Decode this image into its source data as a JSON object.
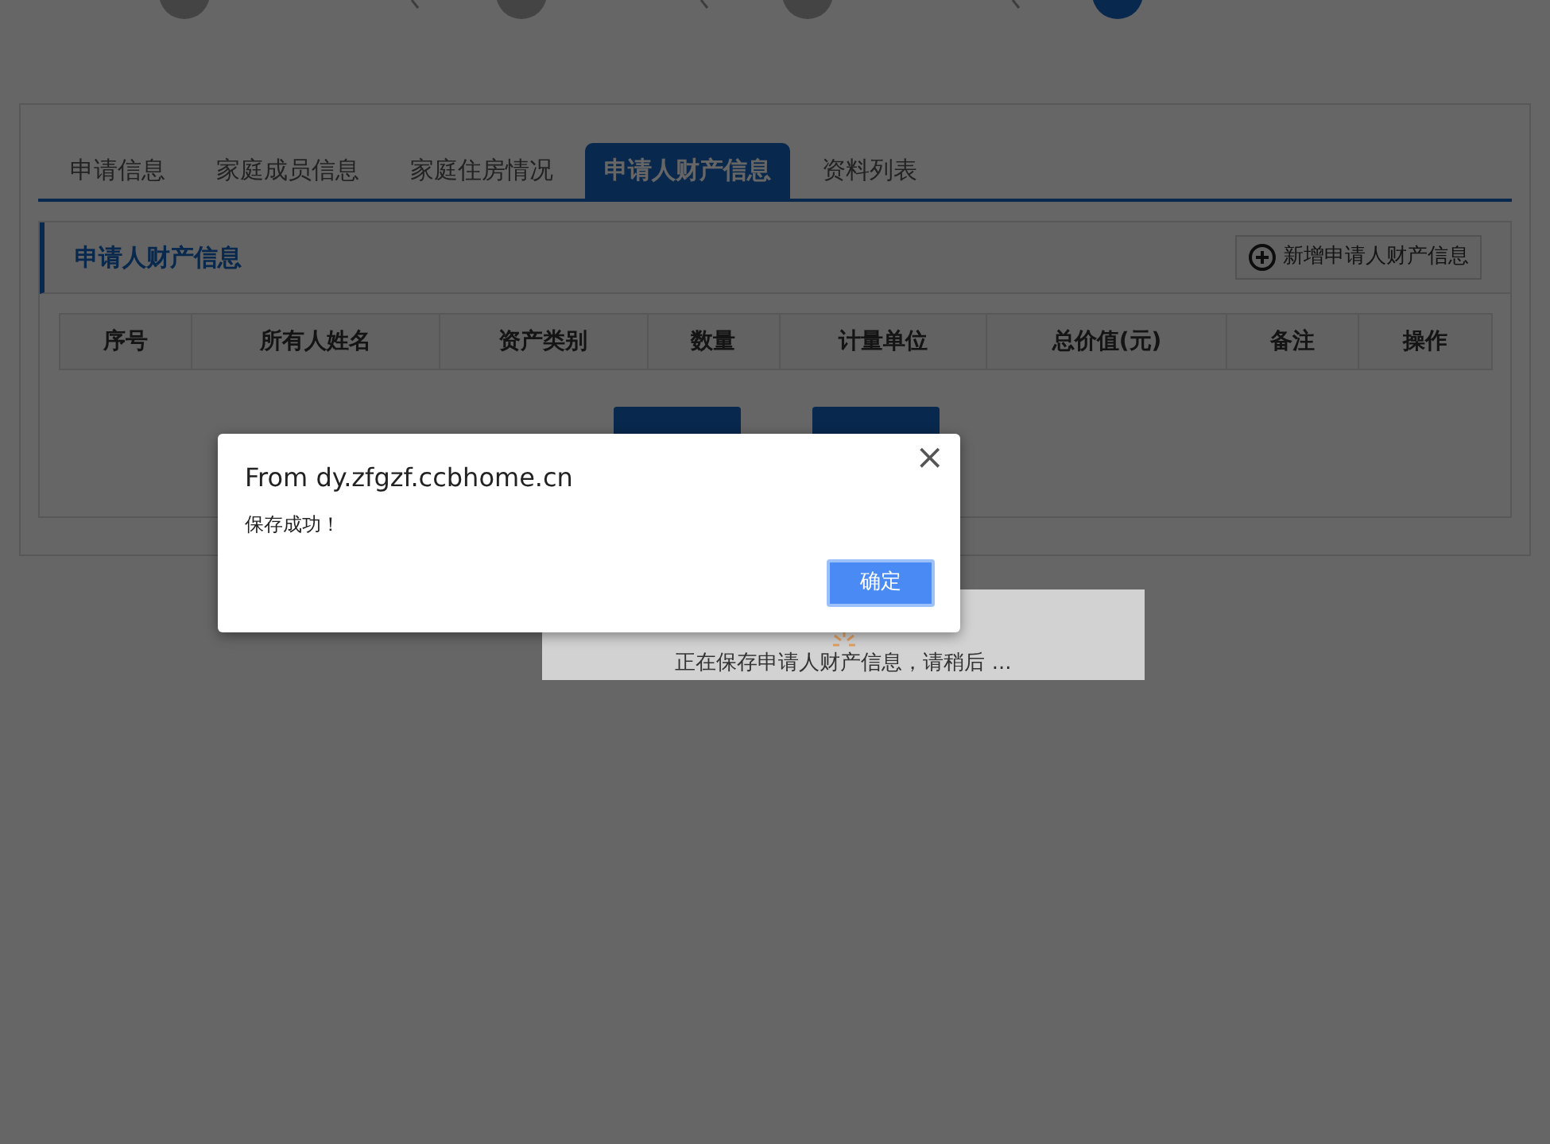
{
  "stepper": {
    "steps": [
      {
        "selected": false
      },
      {
        "selected": false
      },
      {
        "selected": false
      },
      {
        "selected": true
      }
    ]
  },
  "tabs": [
    {
      "label": "申请信息",
      "selected": false
    },
    {
      "label": "家庭成员信息",
      "selected": false
    },
    {
      "label": "家庭住房情况",
      "selected": false
    },
    {
      "label": "申请人财产信息",
      "selected": true
    },
    {
      "label": "资料列表",
      "selected": false
    }
  ],
  "section": {
    "title": "申请人财产信息",
    "add_button": "新增申请人财产信息"
  },
  "table": {
    "columns": [
      "序号",
      "所有人姓名",
      "资产类别",
      "数量",
      "计量单位",
      "总价值(元)",
      "备注",
      "操作"
    ]
  },
  "loading": {
    "message": "正在保存申请人财产信息，请稍后 ..."
  },
  "dialog": {
    "title": "From dy.zfgzf.ccbhome.cn",
    "message": "保存成功！",
    "close": "×",
    "ok_button": "确定"
  }
}
